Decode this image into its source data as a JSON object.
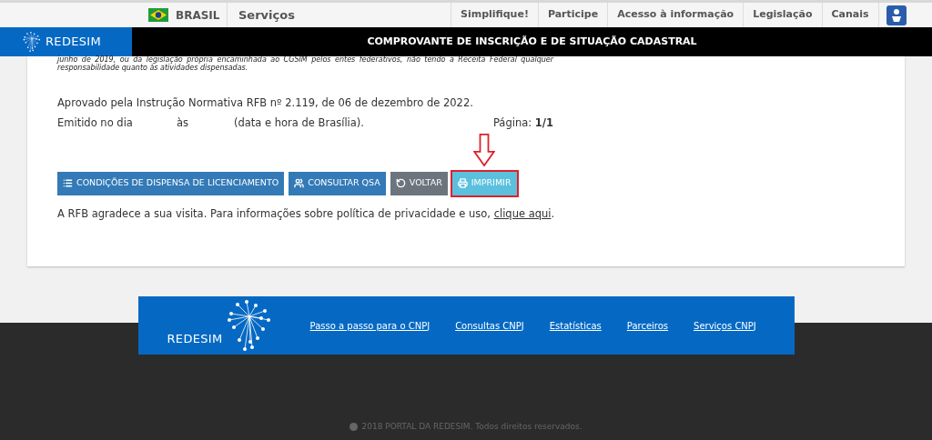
{
  "top_bar": {
    "country": "BRASIL",
    "services": "Serviços",
    "links": [
      "Simplifique!",
      "Participe",
      "Acesso à informação",
      "Legislação",
      "Canais"
    ]
  },
  "header": {
    "logo": "REDESIM",
    "title": "COMPROVANTE DE INSCRIÇÃO E DE SITUAÇÃO CADASTRAL"
  },
  "card": {
    "note_lines": [
      "junho de 2019, ou da legislação própria encaminhada ao CGSIM pelos entes federativos, não tendo a Receita Federal qualquer",
      "responsabilidade quanto às atividades dispensadas."
    ],
    "approved": "Aprovado pela Instrução Normativa RFB nº 2.119, de 06 de dezembro de 2022.",
    "issued": {
      "label": "Emitido no dia",
      "at": "às",
      "suffix": "(data e hora de Brasília).",
      "page_label": "Página:",
      "page": "1/1"
    },
    "buttons": [
      {
        "kind": "list",
        "label": "CONDIÇÕES DE DISPENSA DE LICENCIAMENTO",
        "highlighted": false
      },
      {
        "kind": "users",
        "label": "CONSULTAR QSA",
        "highlighted": false
      },
      {
        "kind": "back",
        "label": "VOLTAR",
        "highlighted": false
      },
      {
        "kind": "print",
        "label": "IMPRIMIR",
        "highlighted": true
      }
    ],
    "thanks": "A RFB agradece a sua visita. Para informações sobre política de privacidade e uso,",
    "thanks_link": "clique aqui",
    "thanks_end": "."
  },
  "footer": {
    "logo": "REDESIM",
    "links": [
      "Passo a passo para o CNPJ",
      "Consultas CNPJ",
      "Estatísticas",
      "Parceiros",
      "Serviços CNPJ"
    ],
    "copyright": "2018 PORTAL DA REDESIM. Todos direitos reservados."
  }
}
